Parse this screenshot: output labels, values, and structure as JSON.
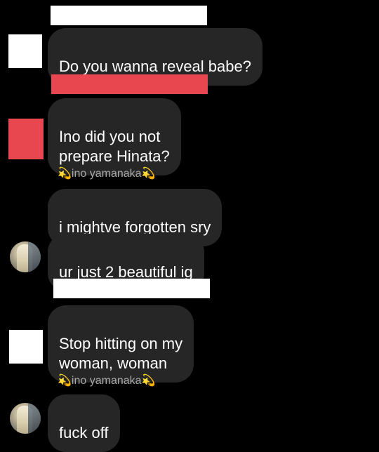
{
  "colors": {
    "background": "#000000",
    "bubble": "#262626",
    "text": "#ffffff",
    "sender_name": "#a8a8a8",
    "redaction_white": "#ffffff",
    "redaction_red": "#e8474f"
  },
  "messages": [
    {
      "text": "Do you wanna reveal babe?"
    },
    {
      "text": "Ino did you not\nprepare Hinata?"
    },
    {
      "sender": "ino yamanaka",
      "sender_icons": [
        "dizzy-star-icon",
        "dizzy-star-icon"
      ],
      "text": "i mightve forgotten sry"
    },
    {
      "text": "ur just 2 beautiful ig"
    },
    {
      "text": "Stop hitting on my\nwoman, woman"
    },
    {
      "sender": "ino yamanaka",
      "sender_icons": [
        "dizzy-star-icon",
        "dizzy-star-icon"
      ],
      "text": "fuck off"
    }
  ],
  "comet_glyph": "💫"
}
